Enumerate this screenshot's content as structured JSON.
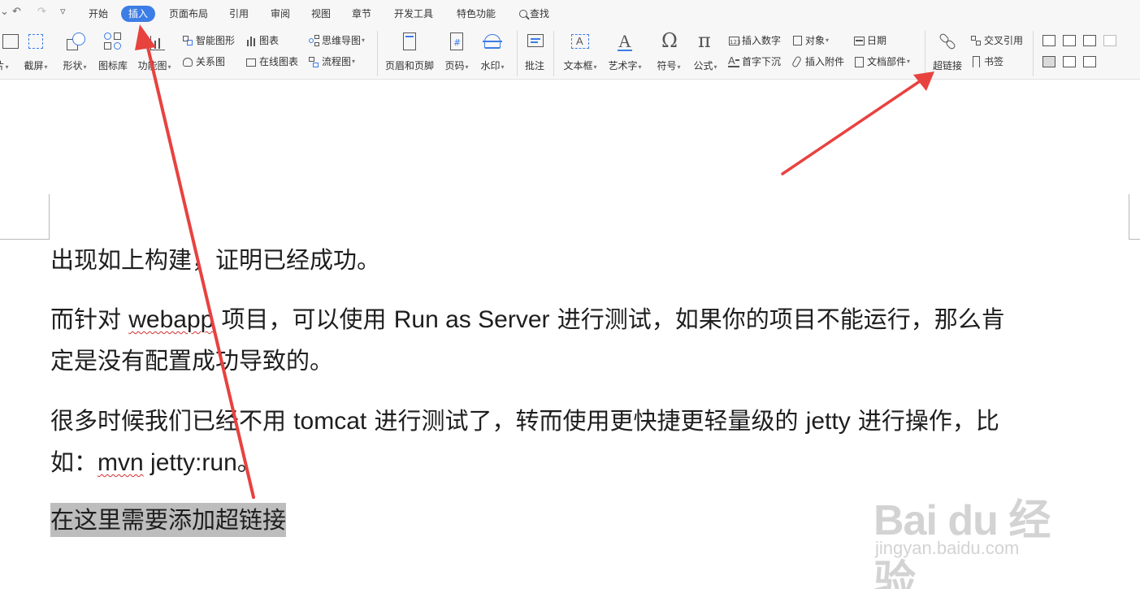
{
  "menubar": {
    "quick_access": [
      "↶",
      "↷",
      "▿"
    ],
    "tabs": [
      {
        "label": "开始"
      },
      {
        "label": "插入"
      },
      {
        "label": "页面布局"
      },
      {
        "label": "引用"
      },
      {
        "label": "审阅"
      },
      {
        "label": "视图"
      },
      {
        "label": "章节"
      },
      {
        "label": "开发工具"
      },
      {
        "label": "特色功能"
      }
    ],
    "active_tab": "插入",
    "search_label": "查找"
  },
  "ribbon": {
    "picture_cut": "片",
    "screenshot": "截屏",
    "shapes": "形状",
    "icon_library": "图标库",
    "function_chart": "功能图",
    "smart_graphic": "智能图形",
    "relation_chart": "关系图",
    "chart": "图表",
    "online_chart": "在线图表",
    "mind_map": "思维导图",
    "flowchart": "流程图",
    "header_footer": "页眉和页脚",
    "page_number": "页码",
    "watermark": "水印",
    "comment": "批注",
    "text_box": "文本框",
    "word_art": "艺术字",
    "symbol": "符号",
    "formula": "公式",
    "insert_number": "插入数字",
    "drop_cap": "首字下沉",
    "object": "对象",
    "insert_attachment": "插入附件",
    "date": "日期",
    "doc_parts": "文档部件",
    "hyperlink": "超链接",
    "cross_reference": "交叉引用",
    "bookmark": "书签"
  },
  "document": {
    "p1": "出现如上构建，证明已经成功。",
    "p2": {
      "a": "而针对 ",
      "b": "webapp",
      "c": " 项目，可以使用 ",
      "d": "Run as Server",
      "e": " 进行测试，如果你的项目不能运行，那么肯",
      "f": "定是没有配置成功导致的。"
    },
    "p3": {
      "a": "很多时候我们已经不用 ",
      "b": "tomcat",
      "c": " 进行测试了，转而使用更快捷更轻量级的 ",
      "d": "jetty",
      "e": " 进行操作，比",
      "f": "如：",
      "g": "mvn",
      "h": " jetty:run",
      "i": "。"
    },
    "p4": "在这里需要添加超链接"
  },
  "watermark": {
    "logo": "Bai du 经验",
    "site": "jingyan.baidu.com"
  },
  "colors": {
    "accent": "#3d7de6",
    "arrow": "#e8423f",
    "highlight": "#bdbdbd"
  }
}
